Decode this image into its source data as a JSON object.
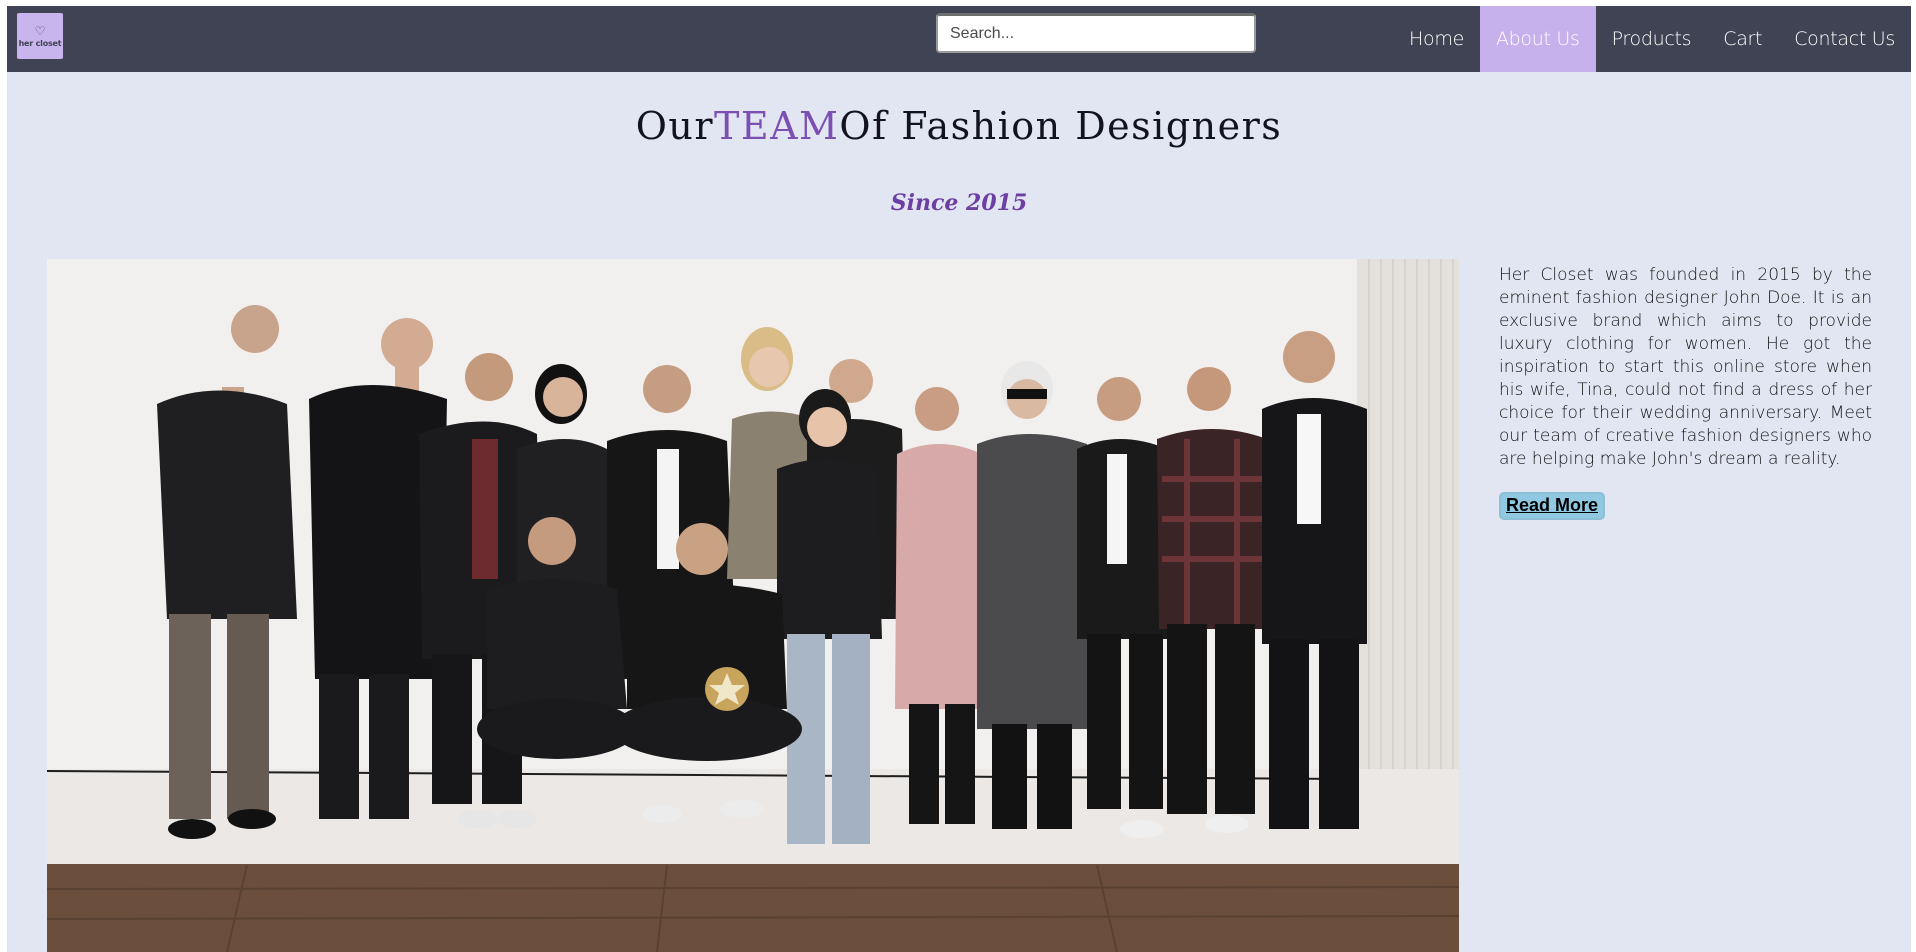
{
  "app": {
    "brand": "her closet"
  },
  "search": {
    "placeholder": "Search...",
    "value": ""
  },
  "nav": {
    "items": [
      {
        "label": "Home",
        "active": false
      },
      {
        "label": "About Us",
        "active": true
      },
      {
        "label": "Products",
        "active": false
      },
      {
        "label": "Cart",
        "active": false
      },
      {
        "label": "Contact Us",
        "active": false
      }
    ]
  },
  "main": {
    "title_prefix": "Our",
    "title_accent": "TEAM",
    "title_suffix": "Of Fashion Designers",
    "subtitle": "Since 2015",
    "about_text": "Her Closet was founded in 2015 by the eminent fashion designer John Doe. It is an exclusive brand which aims to provide luxury clothing for women. He got the inspiration to start this online store when his wife, Tina, could not find a dress of her choice for their wedding anniversary. Meet our team of creative fashion designers who are helping make John's dream a reality.",
    "read_more_label": "Read More"
  },
  "colors": {
    "navbar": "#3f4353",
    "nav_active": "#c6b1ec",
    "page_bg": "#e1e6f2",
    "accent_purple": "#7c4fb2",
    "button_bg": "#8fc8e0"
  },
  "icons": {
    "logo": "heart-icon"
  }
}
